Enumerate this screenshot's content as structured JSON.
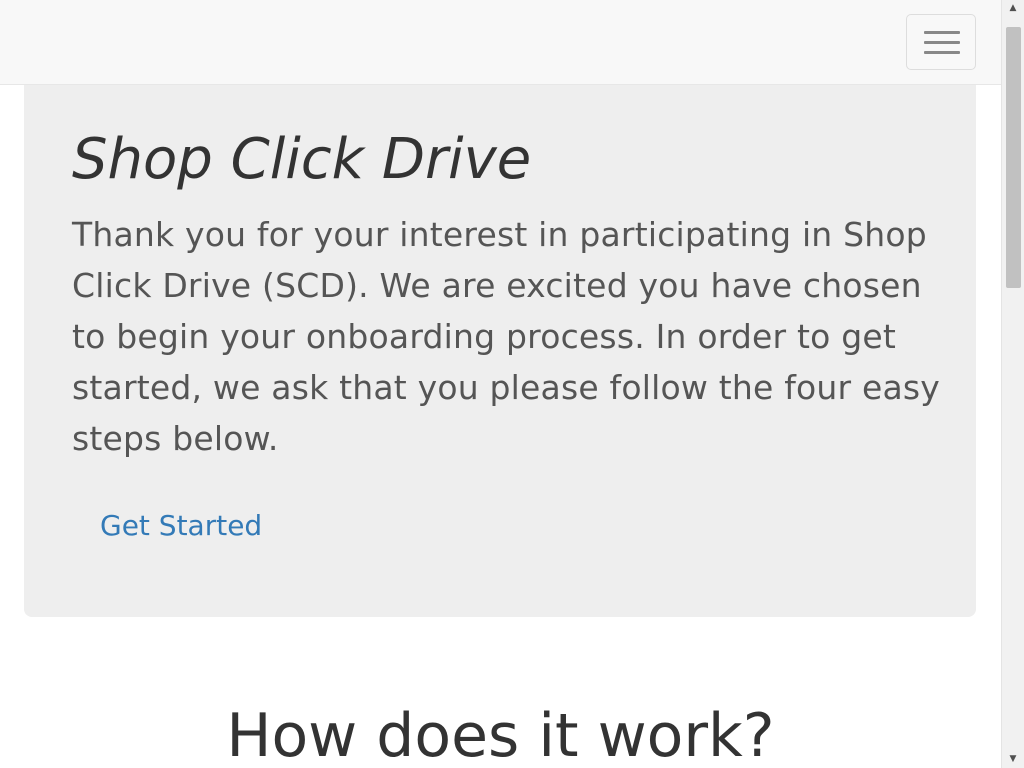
{
  "navbar": {
    "toggle_icon": "hamburger-menu-icon"
  },
  "hero": {
    "title": "Shop Click Drive",
    "text": "Thank you for your interest in participating in Shop Click Drive (SCD). We are excited you have chosen to begin your onboarding process. In order to get started, we ask that you please follow the four easy steps below.",
    "cta_label": "Get Started"
  },
  "section": {
    "heading": "How does it work?"
  },
  "scrollbar": {
    "up_arrow": "▲",
    "down_arrow": "▼"
  },
  "colors": {
    "navbar_bg": "#f8f8f8",
    "jumbotron_bg": "#eeeeee",
    "link": "#337ab7",
    "title_text": "#333333",
    "body_text": "#555555"
  }
}
